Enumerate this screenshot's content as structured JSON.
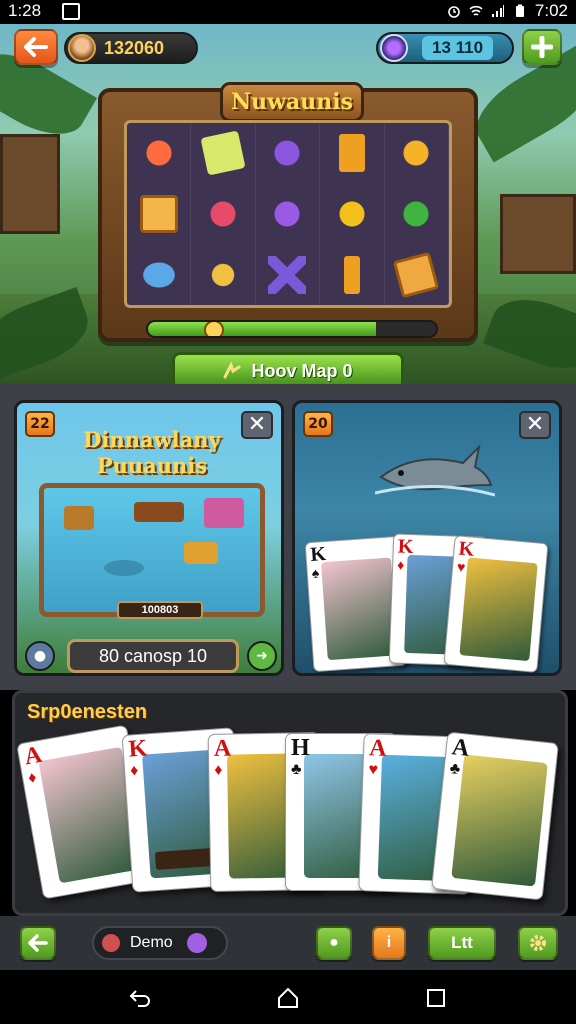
{
  "status_bar": {
    "time_left": "1:28",
    "time_right": "7:02"
  },
  "header": {
    "coins": "132060",
    "gems": "13 110"
  },
  "slot_machine": {
    "title": "Nuwaunis",
    "progress": 0.79
  },
  "map_button": {
    "label": "Hoov Map 0"
  },
  "panel_left": {
    "level": "22",
    "title_line1": "Dinnawlany",
    "title_line2": "Puuaunis",
    "board_score": "100803",
    "search_text": "80 canosp 10"
  },
  "panel_right": {
    "level": "20",
    "cards": [
      {
        "rank": "K",
        "suit": "♠",
        "color": "black"
      },
      {
        "rank": "K",
        "suit": "♦",
        "color": "red"
      },
      {
        "rank": "K",
        "suit": "♥",
        "color": "red"
      }
    ]
  },
  "hand": {
    "title": "Srp0enesten",
    "cards": [
      {
        "rank": "A",
        "suit": "♦",
        "color": "red"
      },
      {
        "rank": "K",
        "suit": "♦",
        "color": "red"
      },
      {
        "rank": "A",
        "suit": "♦",
        "color": "red"
      },
      {
        "rank": "H",
        "suit": "♣",
        "color": "black"
      },
      {
        "rank": "A",
        "suit": "♥",
        "color": "red"
      },
      {
        "rank": "A",
        "suit": "♣",
        "color": "black"
      }
    ]
  },
  "toolbar": {
    "demo_label": "Demo",
    "ltt_label": "Ltt"
  },
  "icons": {
    "back": "back-arrow-icon",
    "plus": "plus-icon",
    "close": "close-icon",
    "gear": "gear-icon"
  }
}
